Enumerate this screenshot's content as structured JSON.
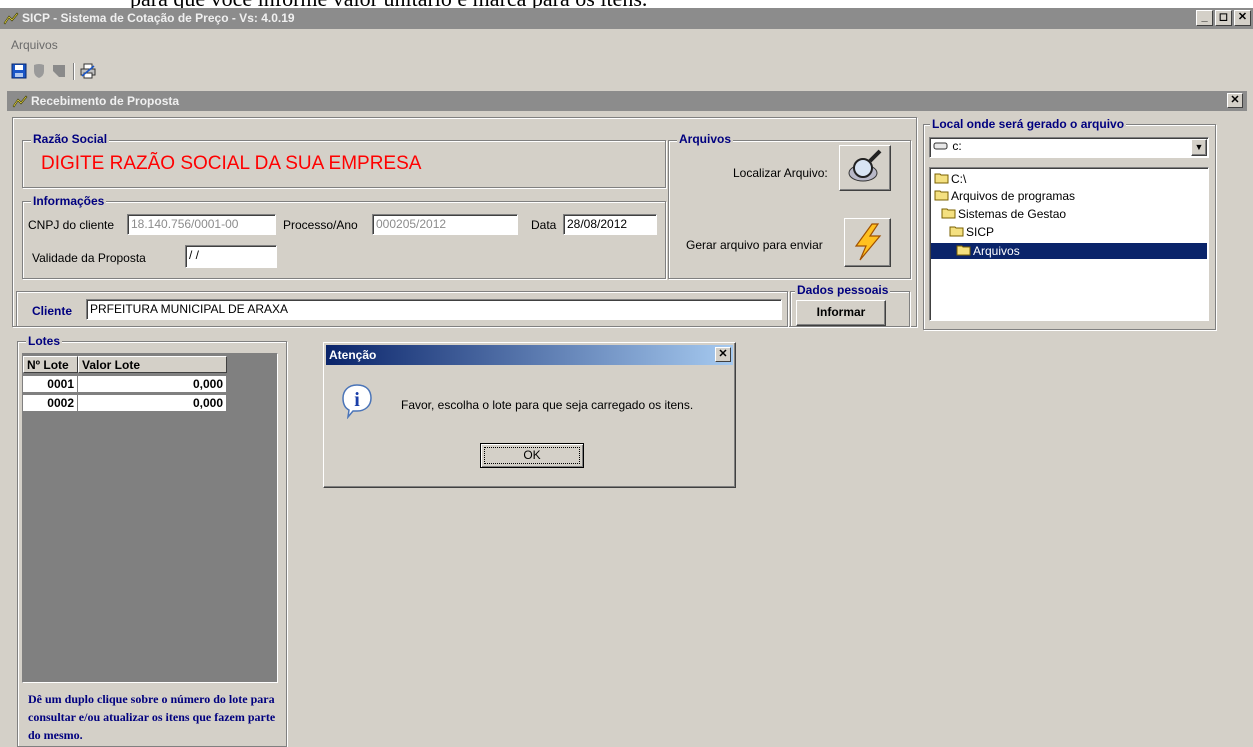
{
  "document_text": "para que você informe valor unitário e marca para os itens.",
  "app": {
    "title": "SICP - Sistema de Cotação de Preço - Vs: 4.0.19",
    "menu": [
      "Arquivos"
    ],
    "window_buttons": [
      "minimize",
      "restore",
      "close"
    ]
  },
  "toolbar": {
    "icons": [
      "save-icon",
      "shield-icon",
      "stop-icon",
      "print-icon"
    ]
  },
  "child_window": {
    "title": "Recebimento de Proposta",
    "razao_social": {
      "legend": "Razão Social",
      "value": "DIGITE RAZÃO SOCIAL DA SUA EMPRESA"
    },
    "informacoes": {
      "legend": "Informações",
      "cnpj_label": "CNPJ do cliente",
      "cnpj_value": "18.140.756/0001-00",
      "processo_label": "Processo/Ano",
      "processo_value": "000205/2012",
      "data_label": "Data",
      "data_value": "28/08/2012",
      "validade_label": "Validade da Proposta",
      "validade_value": " / /"
    },
    "arquivos": {
      "legend": "Arquivos",
      "localizar_label": "Localizar Arquivo:",
      "gerar_label": "Gerar arquivo para enviar"
    },
    "local": {
      "legend": "Local onde será gerado o arquivo",
      "drive": "c:",
      "tree": [
        "C:\\",
        "Arquivos de programas",
        "Sistemas de Gestao",
        "SICP",
        "Arquivos"
      ],
      "selected": "Arquivos"
    },
    "cliente": {
      "label": "Cliente",
      "value": "PRFEITURA MUNICIPAL DE ARAXA"
    },
    "dados_pessoais": {
      "legend": "Dados pessoais",
      "button": "Informar"
    },
    "lotes": {
      "legend": "Lotes",
      "columns": [
        "Nº Lote",
        "Valor Lote"
      ],
      "rows": [
        {
          "lote": "0001",
          "valor": "0,000"
        },
        {
          "lote": "0002",
          "valor": "0,000"
        }
      ],
      "hint": "Dê um duplo clique sobre o número do lote para consultar  e/ou  atualizar os itens que fazem parte do mesmo."
    }
  },
  "dialog": {
    "title": "Atenção",
    "message": "Favor, escolha o lote para que seja carregado os itens.",
    "ok": "OK"
  },
  "colors": {
    "window_bg": "#d4d0c8",
    "inactive_title": "#8c8c8c",
    "legend_blue": "#00007f",
    "razao_red": "#ff0000",
    "selection": "#0a246a"
  }
}
